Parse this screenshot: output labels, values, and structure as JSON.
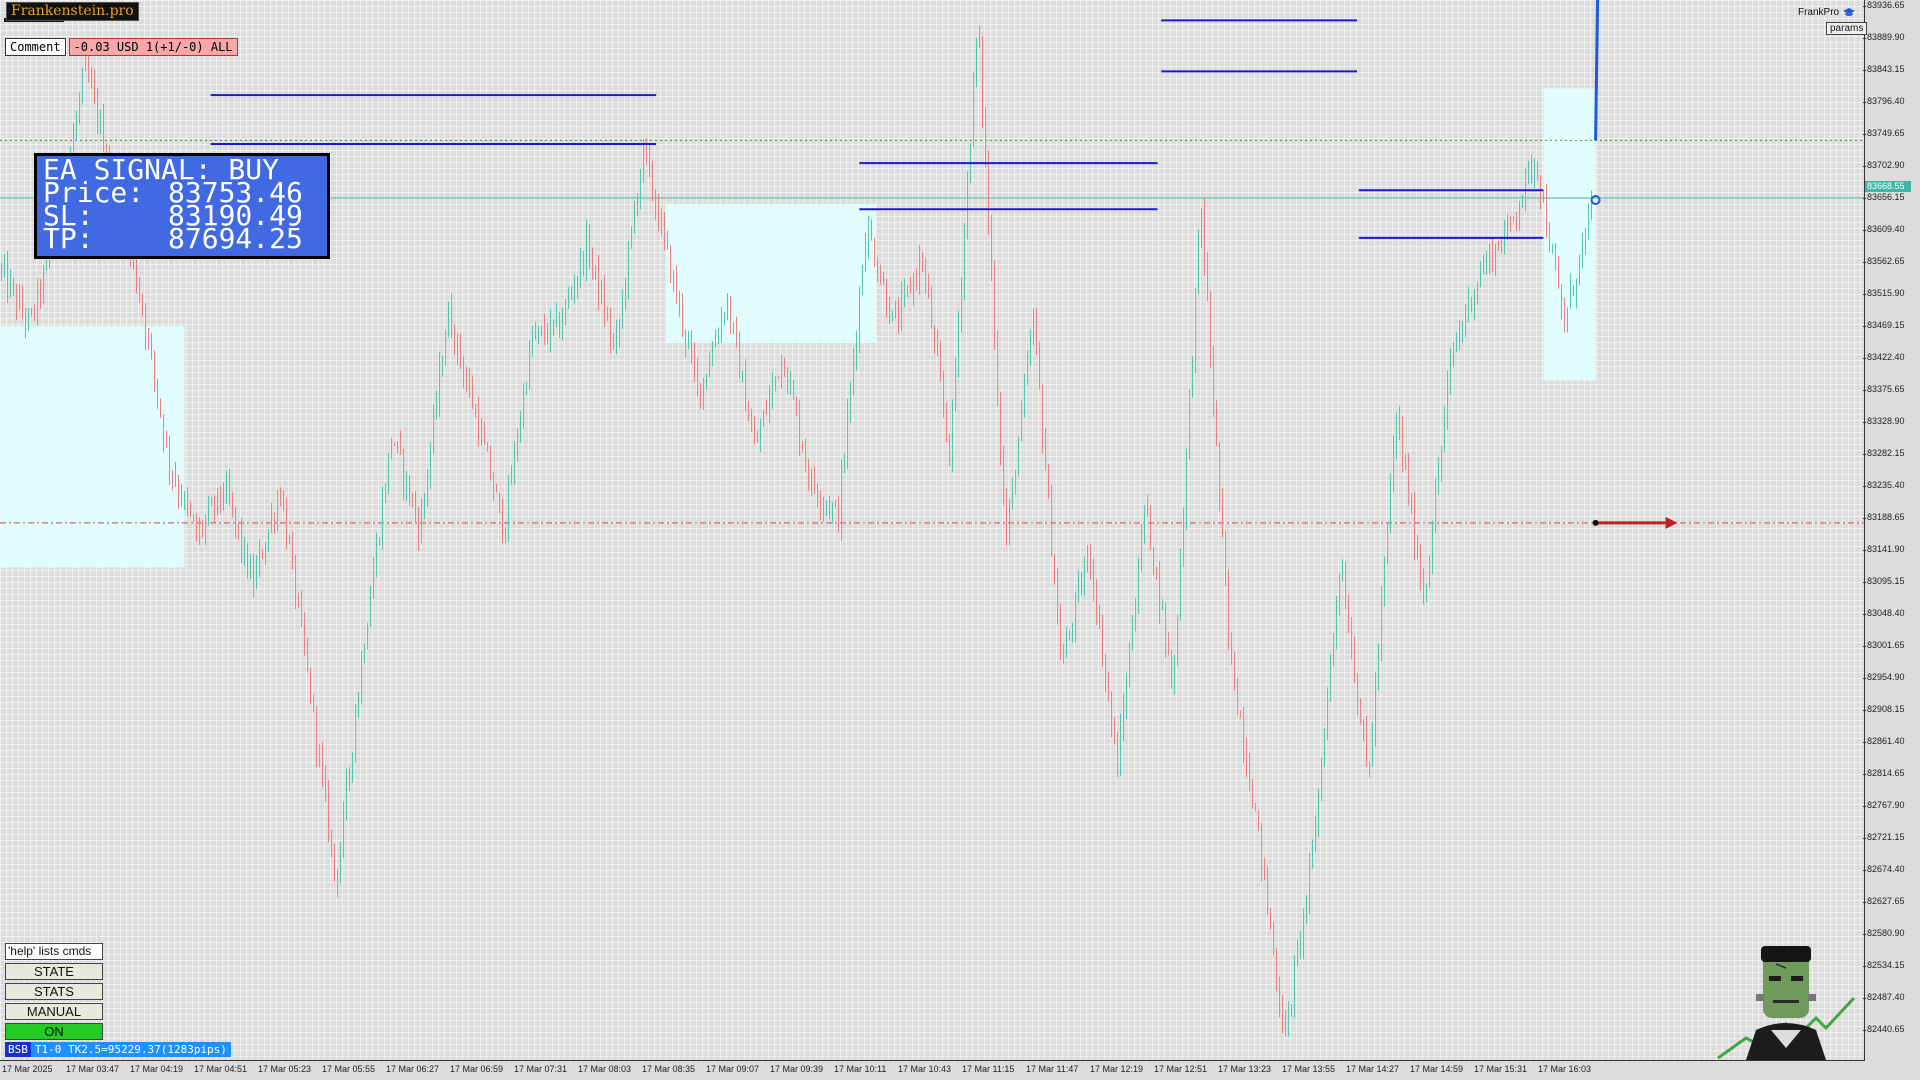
{
  "brand": {
    "logo_text": "Frankenstein.pro",
    "top_right_label": "FrankPro",
    "params_label": "params"
  },
  "comment": {
    "label": "Comment",
    "value": "-0.03 USD 1(+1/-0) ALL"
  },
  "signal": {
    "title": "EA SIGNAL: BUY",
    "rows": [
      {
        "key": "Price:",
        "value": "83753.46"
      },
      {
        "key": "SL:",
        "value": "83190.49"
      },
      {
        "key": "TP:",
        "value": "87694.25"
      }
    ]
  },
  "panel": {
    "help_label": "'help' lists cmds",
    "state_label": "STATE",
    "stats_label": "STATS",
    "manual_label": "MANUAL",
    "on_label": "ON"
  },
  "status_bar": {
    "badge": "BSB",
    "text": "T1-0  TK2.5=95229.37(1283pips)"
  },
  "price_axis": {
    "ticks": [
      "83936.65",
      "83889.90",
      "83843.15",
      "83796.40",
      "83749.65",
      "83702.90",
      "83656.15",
      "83609.40",
      "83562.65",
      "83515.90",
      "83469.15",
      "83422.40",
      "83375.65",
      "83328.90",
      "83282.15",
      "83235.40",
      "83188.65",
      "83141.90",
      "83095.15",
      "83048.40",
      "83001.65",
      "82954.90",
      "82908.15",
      "82861.40",
      "82814.65",
      "82767.90",
      "82721.15",
      "82674.40",
      "82627.65",
      "82580.90",
      "82534.15",
      "82487.40",
      "82440.65"
    ],
    "current_price": "83668.55"
  },
  "time_axis": {
    "ticks": [
      "17 Mar 2025",
      "17 Mar 03:47",
      "17 Mar 04:19",
      "17 Mar 04:51",
      "17 Mar 05:23",
      "17 Mar 05:55",
      "17 Mar 06:27",
      "17 Mar 06:59",
      "17 Mar 07:31",
      "17 Mar 08:03",
      "17 Mar 08:35",
      "17 Mar 09:07",
      "17 Mar 09:39",
      "17 Mar 10:11",
      "17 Mar 10:43",
      "17 Mar 11:15",
      "17 Mar 11:47",
      "17 Mar 12:19",
      "17 Mar 12:51",
      "17 Mar 13:23",
      "17 Mar 13:55",
      "17 Mar 14:27",
      "17 Mar 14:59",
      "17 Mar 15:31",
      "17 Mar 16:03"
    ]
  },
  "chart_data": {
    "type": "candlestick",
    "y_range": [
      82400,
      83960
    ],
    "bull_color": "#4ec9b0",
    "bear_color": "#f08080",
    "zone_color": "#e0ffff",
    "level_color": "#1a1ad0",
    "stop_line_color": "#d04040",
    "current_line_color": "#3fb7a4",
    "ask_line_color": "#3a9a3a",
    "close_path": [
      83560,
      83480,
      83620,
      83860,
      83700,
      83520,
      83280,
      83170,
      83240,
      83100,
      83240,
      82960,
      82660,
      83020,
      83320,
      83180,
      83500,
      83350,
      83180,
      83460,
      83480,
      83600,
      83440,
      83740,
      83560,
      83380,
      83520,
      83300,
      83440,
      83250,
      83200,
      83630,
      83480,
      83580,
      83290,
      83930,
      83160,
      83490,
      82980,
      83150,
      82830,
      83220,
      82950,
      83660,
      83010,
      82750,
      82430,
      82700,
      83140,
      82810,
      83350,
      83080,
      83440,
      83560,
      83620,
      83730,
      83480,
      83650
    ],
    "zones": [
      {
        "t0": 0.0,
        "t1": 0.099,
        "p_top": 83480,
        "p_bot": 83125
      },
      {
        "t0": 0.357,
        "t1": 0.47,
        "p_top": 83660,
        "p_bot": 83455
      },
      {
        "t0": 0.828,
        "t1": 0.856,
        "p_top": 83830,
        "p_bot": 83400
      }
    ],
    "levels": [
      {
        "t0": 0.113,
        "t1": 0.352,
        "price": 83820
      },
      {
        "t0": 0.113,
        "t1": 0.352,
        "price": 83748
      },
      {
        "t0": 0.461,
        "t1": 0.621,
        "price": 83720
      },
      {
        "t0": 0.461,
        "t1": 0.621,
        "price": 83652
      },
      {
        "t0": 0.623,
        "t1": 0.728,
        "price": 83930
      },
      {
        "t0": 0.623,
        "t1": 0.728,
        "price": 83855
      },
      {
        "t0": 0.729,
        "t1": 0.828,
        "price": 83680
      },
      {
        "t0": 0.729,
        "t1": 0.828,
        "price": 83610
      }
    ],
    "stop_price": 83190.49,
    "current_price": 83668.55,
    "ask_price": 83753.46
  }
}
